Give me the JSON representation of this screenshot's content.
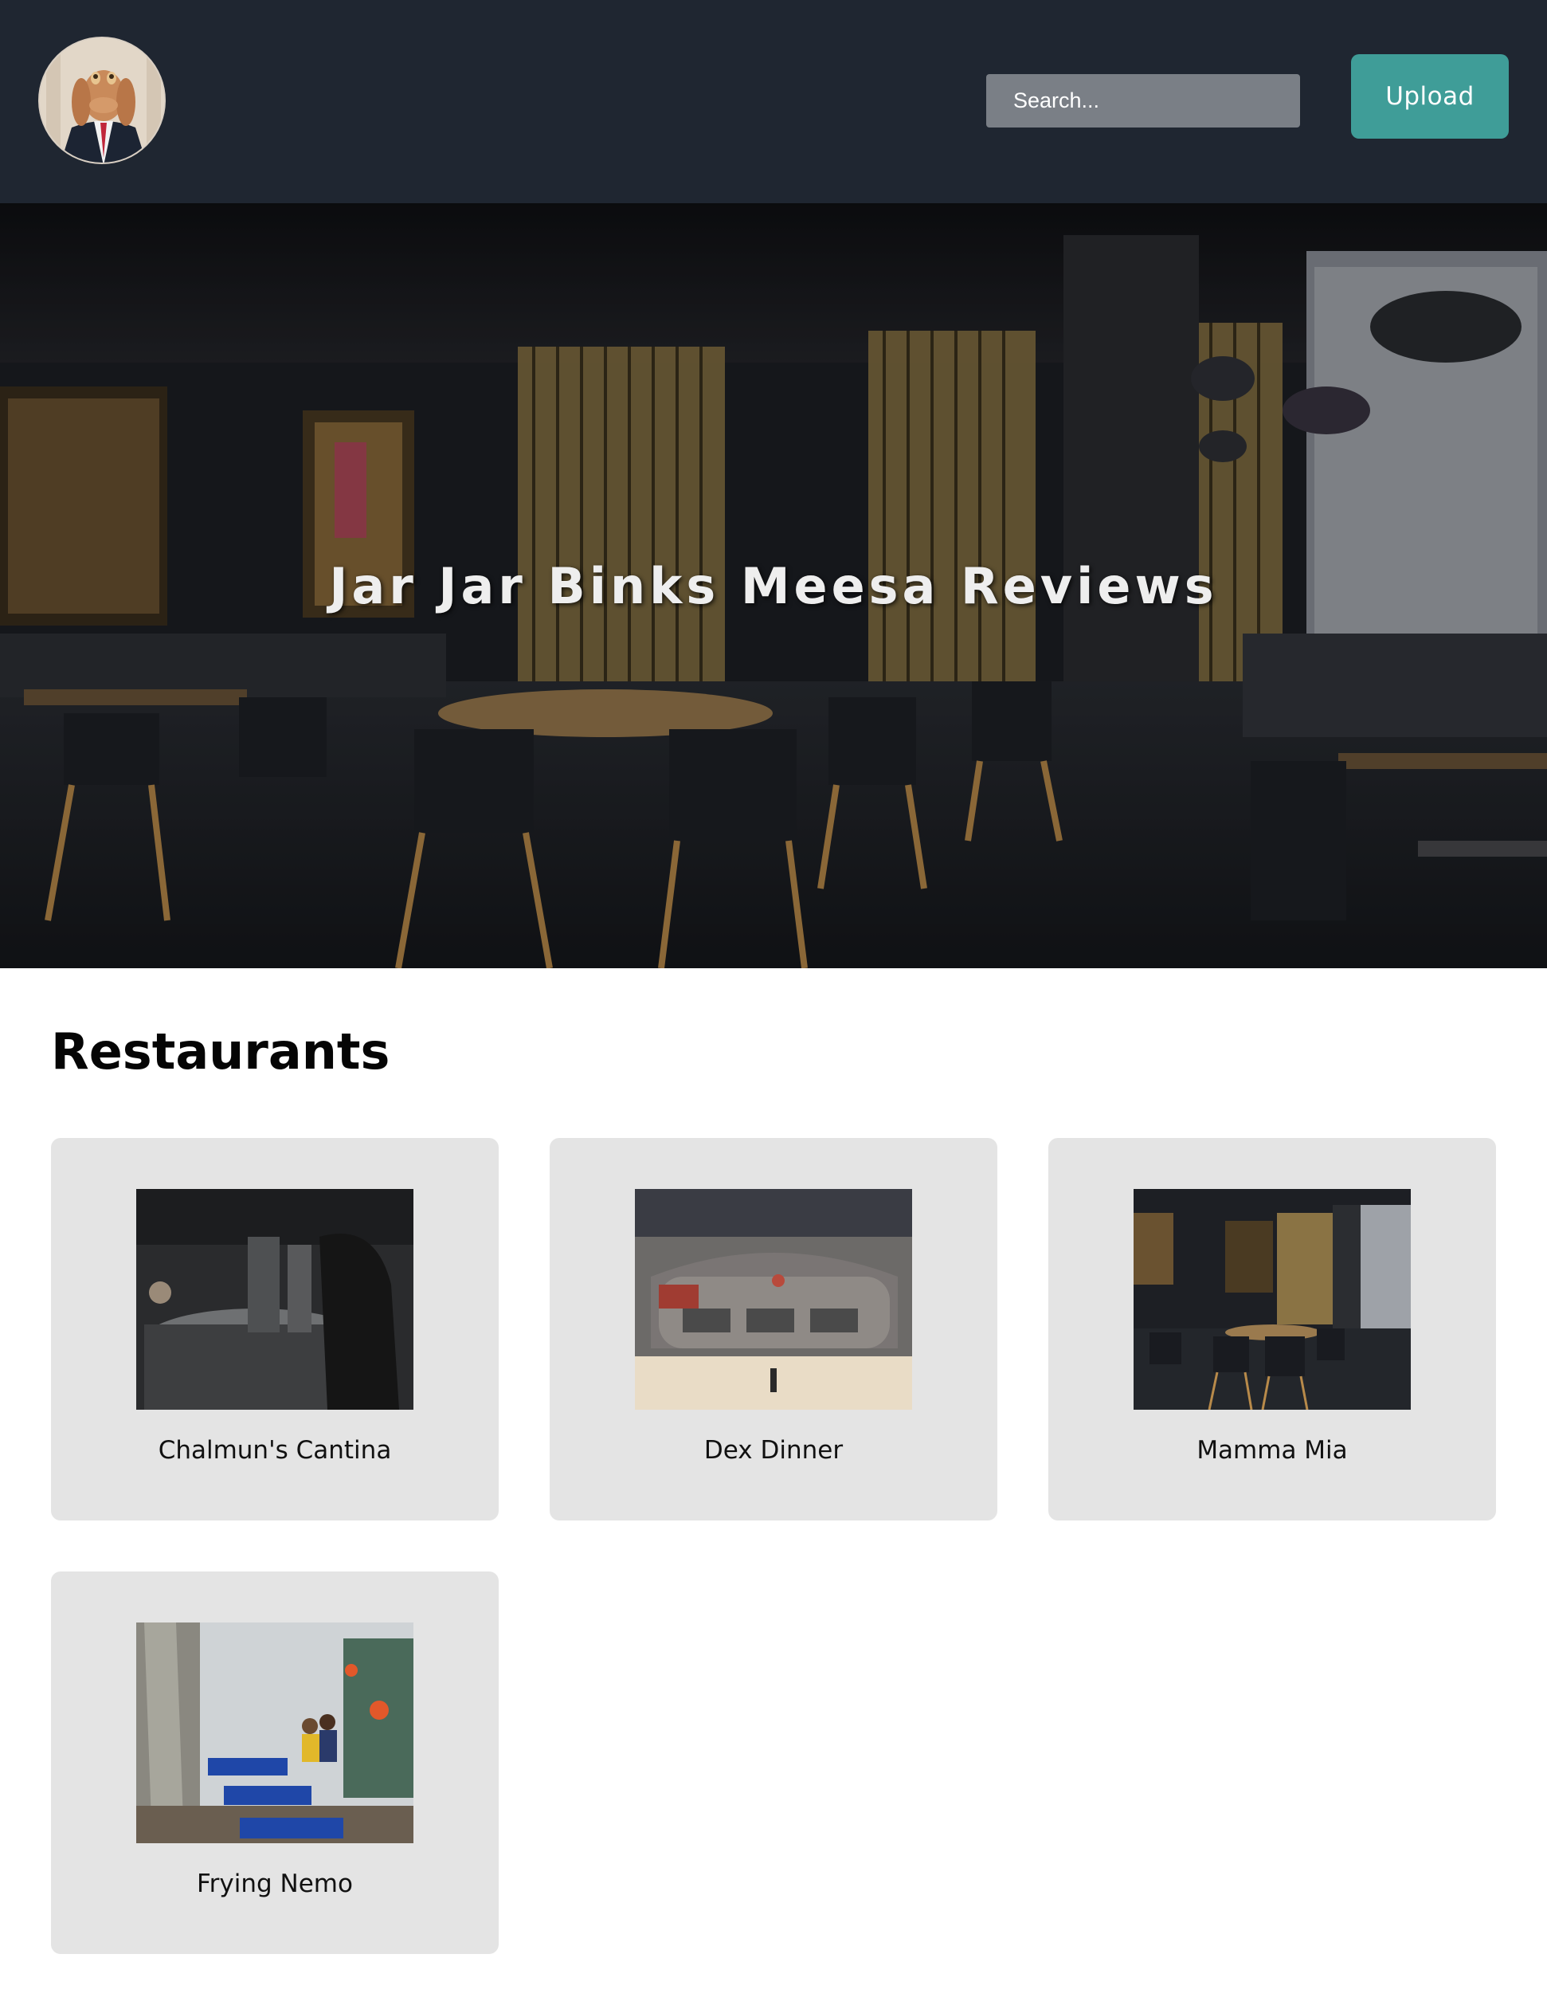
{
  "header": {
    "avatar_alt": "Jar Jar Binks avatar",
    "search_placeholder": "Search...",
    "upload_label": "Upload"
  },
  "hero": {
    "title": "Jar Jar Binks Meesa Reviews"
  },
  "main": {
    "section_title": "Restaurants",
    "restaurants": [
      {
        "name": "Chalmun's Cantina"
      },
      {
        "name": "Dex Dinner"
      },
      {
        "name": "Mamma Mia"
      },
      {
        "name": "Frying Nemo"
      }
    ]
  },
  "colors": {
    "header_bg": "#1f2631",
    "accent": "#3f9d98",
    "card_bg": "#e4e4e4"
  }
}
